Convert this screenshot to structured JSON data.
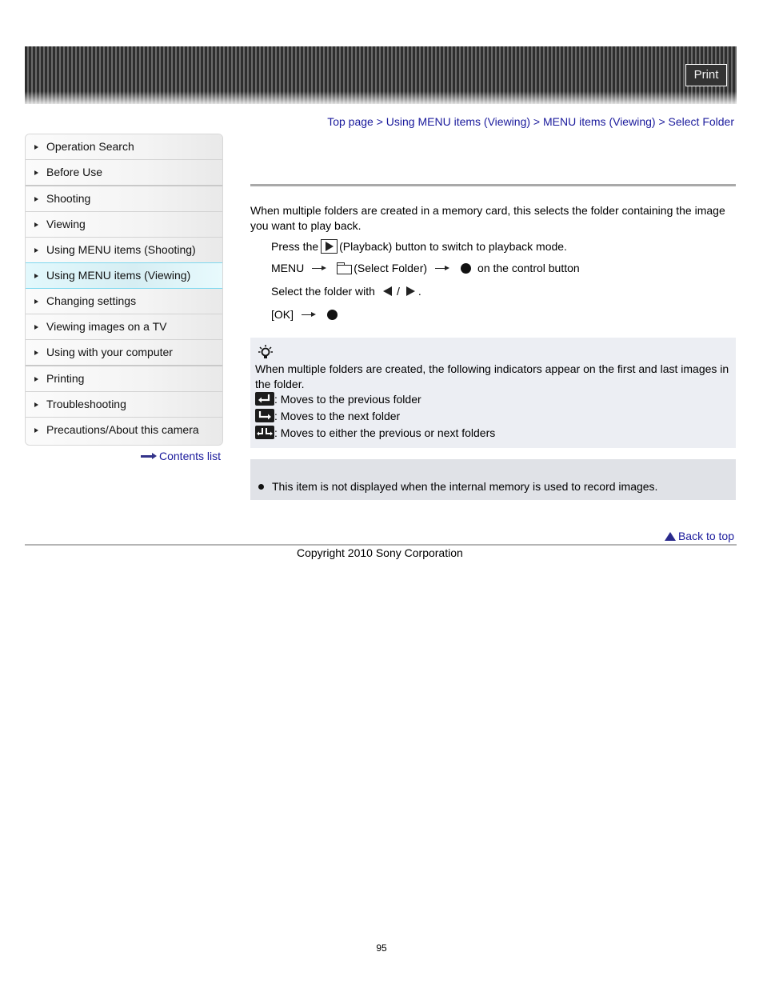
{
  "header": {
    "print_label": "Print"
  },
  "sidebar": {
    "items": [
      {
        "label": "Operation Search",
        "active": false
      },
      {
        "label": "Before Use",
        "active": false
      },
      {
        "label": "Shooting",
        "active": false
      },
      {
        "label": "Viewing",
        "active": false
      },
      {
        "label": "Using MENU items (Shooting)",
        "active": false
      },
      {
        "label": "Using MENU items (Viewing)",
        "active": true
      },
      {
        "label": "Changing settings",
        "active": false
      },
      {
        "label": "Viewing images on a TV",
        "active": false
      },
      {
        "label": "Using with your computer",
        "active": false
      },
      {
        "label": "Printing",
        "active": false
      },
      {
        "label": "Troubleshooting",
        "active": false
      },
      {
        "label": "Precautions/About this camera",
        "active": false
      }
    ],
    "contents_link": "Contents list"
  },
  "breadcrumb": {
    "items": [
      "Top page",
      "Using MENU items (Viewing)",
      "MENU items (Viewing)",
      "Select Folder"
    ],
    "separator": ">"
  },
  "main": {
    "intro": "When multiple folders are created in a memory card, this selects the folder containing the image you want to play back.",
    "steps": {
      "step1_pre": "Press the",
      "step1_post": "(Playback) button to switch to playback mode.",
      "step2_menu": "MENU",
      "step2_mid": "(Select Folder)",
      "step2_post": "on the control button",
      "step3_pre": "Select the folder with",
      "step3_sep": "/",
      "step3_post": ".",
      "step4_pre": "[OK]"
    },
    "hint": {
      "icon": "lightbulb-icon",
      "text": "When multiple folders are created, the following indicators appear on the first and last images in the folder.",
      "indicators": [
        {
          "icon": "previous-folder-icon",
          "text": ": Moves to the previous folder"
        },
        {
          "icon": "next-folder-icon",
          "text": ": Moves to the next folder"
        },
        {
          "icon": "either-folder-icon",
          "text": ": Moves to either the previous or next folders"
        }
      ]
    },
    "note": {
      "text": "This item is not displayed when the internal memory is used to record images."
    }
  },
  "footer": {
    "back_to_top": "Back to top",
    "copyright": "Copyright 2010 Sony Corporation",
    "page_number": "95"
  },
  "colors": {
    "link": "#1a1a9c",
    "active_sidebar": "#d6eef3",
    "hint_bg": "#eceef3",
    "note_bg": "#e0e2e7"
  }
}
